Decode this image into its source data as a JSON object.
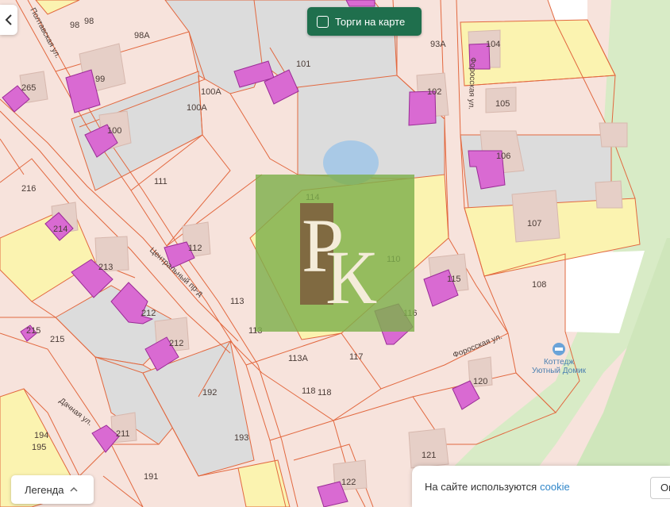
{
  "map": {
    "parcel_numbers": [
      {
        "id": "98a",
        "text": "98"
      },
      {
        "id": "98b",
        "text": "98"
      },
      {
        "id": "98A",
        "text": "98А"
      },
      {
        "id": "99",
        "text": "99"
      },
      {
        "id": "265",
        "text": "265"
      },
      {
        "id": "100",
        "text": "100"
      },
      {
        "id": "100A1",
        "text": "100А"
      },
      {
        "id": "100A2",
        "text": "100А"
      },
      {
        "id": "101",
        "text": "101"
      },
      {
        "id": "93A",
        "text": "93А"
      },
      {
        "id": "102",
        "text": "102"
      },
      {
        "id": "104",
        "text": "104"
      },
      {
        "id": "105",
        "text": "105"
      },
      {
        "id": "106",
        "text": "106"
      },
      {
        "id": "107",
        "text": "107"
      },
      {
        "id": "108",
        "text": "108"
      },
      {
        "id": "111",
        "text": "111"
      },
      {
        "id": "114",
        "text": "114"
      },
      {
        "id": "216",
        "text": "216"
      },
      {
        "id": "214",
        "text": "214"
      },
      {
        "id": "213",
        "text": "213"
      },
      {
        "id": "212a",
        "text": "212"
      },
      {
        "id": "212b",
        "text": "212"
      },
      {
        "id": "215a",
        "text": "215"
      },
      {
        "id": "215b",
        "text": "215"
      },
      {
        "id": "112",
        "text": "112"
      },
      {
        "id": "113a",
        "text": "113"
      },
      {
        "id": "113b",
        "text": "113"
      },
      {
        "id": "110",
        "text": "110"
      },
      {
        "id": "115",
        "text": "115"
      },
      {
        "id": "116",
        "text": "116"
      },
      {
        "id": "117",
        "text": "117"
      },
      {
        "id": "113A",
        "text": "113А"
      },
      {
        "id": "118a",
        "text": "118"
      },
      {
        "id": "118b",
        "text": "118"
      },
      {
        "id": "120",
        "text": "120"
      },
      {
        "id": "121",
        "text": "121"
      },
      {
        "id": "122",
        "text": "122"
      },
      {
        "id": "192",
        "text": "192"
      },
      {
        "id": "193",
        "text": "193"
      },
      {
        "id": "191",
        "text": "191"
      },
      {
        "id": "194",
        "text": "194"
      },
      {
        "id": "195",
        "text": "195"
      },
      {
        "id": "211",
        "text": "211"
      }
    ],
    "streets": {
      "poltavskaya": "Полтавская ул.",
      "forosskaya_north": "Форосская ул.",
      "forosskaya_south": "Форосская ул.",
      "tsentralny": "Центральный пр-д",
      "dachnaya": "Дачная ул."
    },
    "poi": {
      "line1": "Коттедж",
      "line2": "Уютный Домик"
    },
    "colors": {
      "parcel_fill": "#f7e3dc",
      "parcel_border": "#e2683f",
      "grey_parcel": "#dcdcdc",
      "yellow_parcel": "#fbf3b0",
      "building": "#d96ad2",
      "building_border": "#9a2c96",
      "forest": "#d8ebc6",
      "water": "#a9c9e6"
    }
  },
  "controls": {
    "back_icon": "chevron-left-icon",
    "auction_label": "Торги на карте",
    "legend_label": "Легенда",
    "legend_icon": "chevron-up-icon"
  },
  "watermark": {
    "letter1": "Р",
    "letter2": "К"
  },
  "cookie": {
    "text": "На сайте используются",
    "link": "cookie",
    "ok": "Ок"
  }
}
